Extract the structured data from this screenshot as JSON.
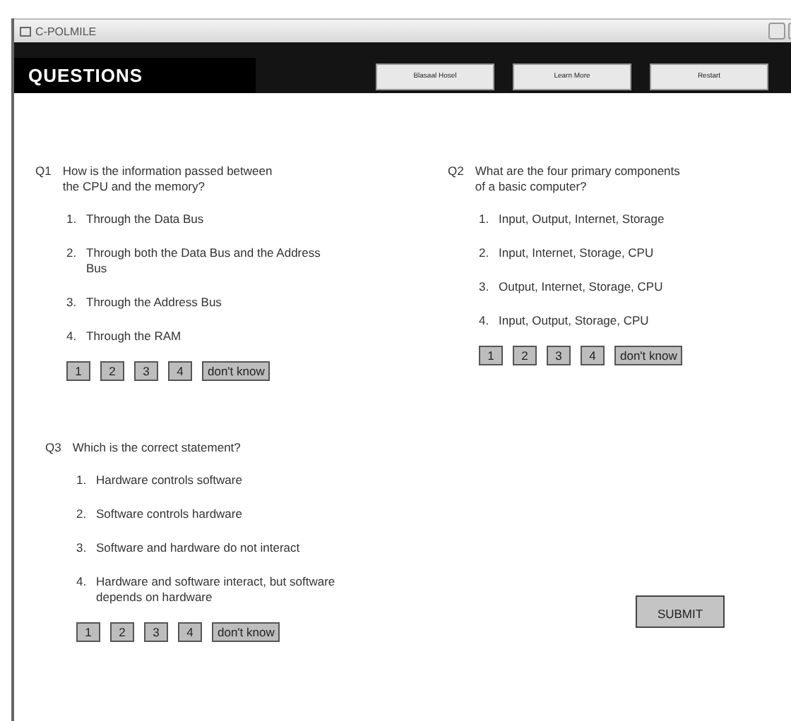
{
  "window": {
    "title": "C-POLMILE"
  },
  "header": {
    "title": "QUESTIONS",
    "buttons": [
      "Blasaal Hosel",
      "Learn More",
      "Restart"
    ]
  },
  "questions": [
    {
      "number": "Q1",
      "text": "How is the information passed between the CPU and the memory?",
      "options": [
        {
          "number": "1.",
          "text": "Through the Data Bus"
        },
        {
          "number": "2.",
          "text": "Through both the Data Bus and the Address Bus"
        },
        {
          "number": "3.",
          "text": "Through the Address Bus"
        },
        {
          "number": "4.",
          "text": "Through the RAM"
        }
      ],
      "answers": [
        "1",
        "2",
        "3",
        "4",
        "don't know"
      ]
    },
    {
      "number": "Q2",
      "text": "What are the four primary components of a basic computer?",
      "options": [
        {
          "number": "1.",
          "text": "Input, Output, Internet, Storage"
        },
        {
          "number": "2.",
          "text": "Input, Internet, Storage, CPU"
        },
        {
          "number": "3.",
          "text": "Output, Internet, Storage, CPU"
        },
        {
          "number": "4.",
          "text": "Input, Output, Storage, CPU"
        }
      ],
      "answers": [
        "1",
        "2",
        "3",
        "4",
        "don't know"
      ]
    },
    {
      "number": "Q3",
      "text": "Which is the correct statement?",
      "options": [
        {
          "number": "1.",
          "text": "Hardware controls software"
        },
        {
          "number": "2.",
          "text": "Software controls hardware"
        },
        {
          "number": "3.",
          "text": "Software and hardware do not interact"
        },
        {
          "number": "4.",
          "text": "Hardware and software interact, but software depends on hardware"
        }
      ],
      "answers": [
        "1",
        "2",
        "3",
        "4",
        "don't know"
      ]
    }
  ],
  "submit": "SUBMIT"
}
